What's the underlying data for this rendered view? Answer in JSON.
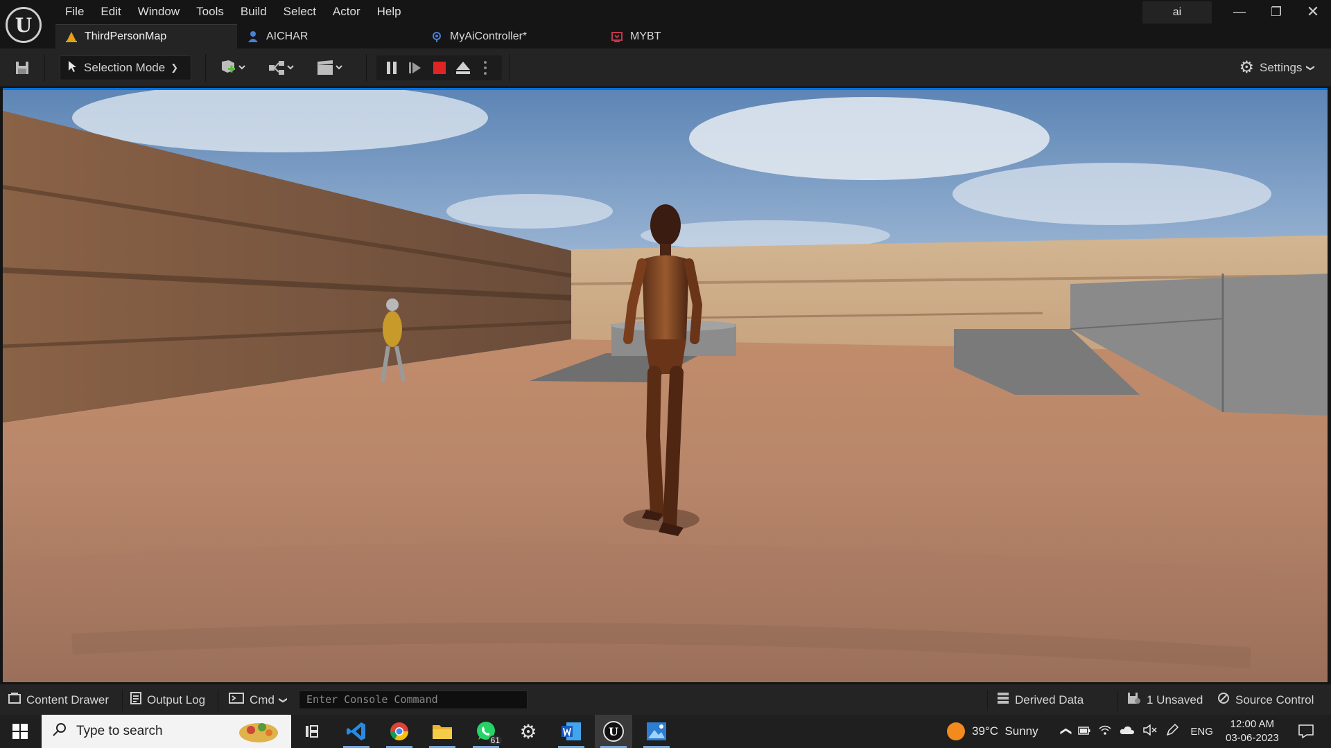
{
  "menu": [
    "File",
    "Edit",
    "Window",
    "Tools",
    "Build",
    "Select",
    "Actor",
    "Help"
  ],
  "search_box": "ai",
  "tabs": [
    {
      "label": "ThirdPersonMap",
      "icon": "level-icon"
    },
    {
      "label": "AICHAR",
      "icon": "character-icon"
    },
    {
      "label": "MyAiController*",
      "icon": "controller-icon"
    },
    {
      "label": "MYBT",
      "icon": "behavior-tree-icon"
    }
  ],
  "toolbar": {
    "selection_mode": "Selection Mode",
    "settings": "Settings"
  },
  "status_bar": {
    "content_drawer": "Content Drawer",
    "output_log": "Output Log",
    "cmd": "Cmd",
    "console_placeholder": "Enter Console Command",
    "derived_data": "Derived Data",
    "unsaved": "1 Unsaved",
    "source_control": "Source Control"
  },
  "taskbar": {
    "search_placeholder": "Type to search",
    "whatsapp_badge": "61",
    "weather": "39°C  Sunny",
    "language": "ENG",
    "time": "12:00 AM",
    "date": "03-06-2023"
  },
  "colors": {
    "accent": "#0070e0",
    "stop_button": "#e02424",
    "titlebar": "#151515",
    "toolbar": "#242424"
  }
}
